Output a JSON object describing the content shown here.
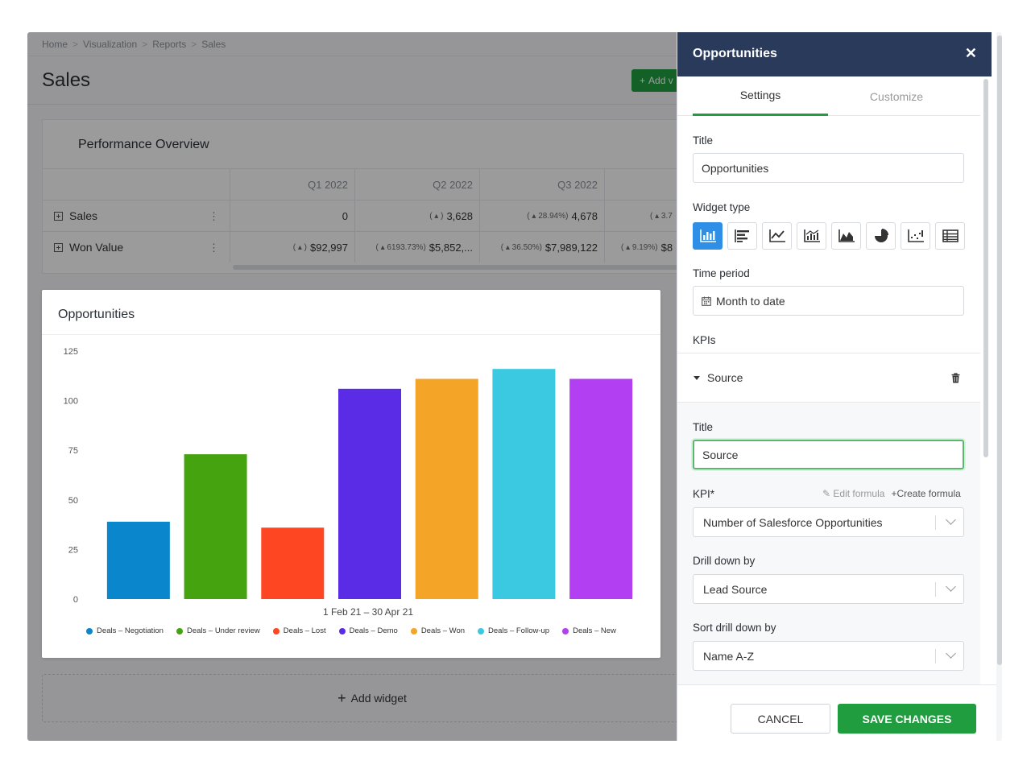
{
  "breadcrumb": [
    "Home",
    "Visualization",
    "Reports",
    "Sales"
  ],
  "page": {
    "title": "Sales",
    "add_button": "Add v"
  },
  "performance": {
    "title": "Performance Overview",
    "columns": [
      "Q1 2022",
      "Q2 2022",
      "Q3 2022"
    ],
    "rows": [
      {
        "label": "Sales",
        "values": [
          {
            "change": "",
            "value": "0"
          },
          {
            "change": "( ▴ )",
            "value": "3,628"
          },
          {
            "change": "( ▴ 28.94%)",
            "value": "4,678"
          },
          {
            "change": "( ▴ 3.7",
            "value": ""
          }
        ]
      },
      {
        "label": "Won Value",
        "values": [
          {
            "change": "( ▴ )",
            "value": "$92,997"
          },
          {
            "change": "( ▴ 6193.73%)",
            "value": "$5,852,..."
          },
          {
            "change": "( ▴ 36.50%)",
            "value": "$7,989,122"
          },
          {
            "change": "( ▴ 9.19%)",
            "value": "$8"
          }
        ]
      }
    ]
  },
  "widget": {
    "title": "Opportunities"
  },
  "chart_data": {
    "type": "bar",
    "title": "Opportunities",
    "xlabel": "1 Feb 21 – 30 Apr 21",
    "ylabel": "",
    "ylim": [
      0,
      125
    ],
    "yticks": [
      0,
      25,
      50,
      75,
      100,
      125
    ],
    "categories": [
      "Deals – Negotiation",
      "Deals – Under review",
      "Deals – Lost",
      "Deals – Demo",
      "Deals – Won",
      "Deals – Follow-up",
      "Deals – New"
    ],
    "values": [
      39,
      73,
      36,
      106,
      111,
      116,
      111
    ],
    "colors": [
      "#0a86cc",
      "#44a30f",
      "#ff4622",
      "#5a2ce6",
      "#f4a426",
      "#3bc9e2",
      "#b23ff2"
    ],
    "legend": "bottom",
    "grid": false
  },
  "add_widget": "Add widget",
  "panel": {
    "title": "Opportunities",
    "tabs": [
      "Settings",
      "Customize"
    ],
    "title_label": "Title",
    "title_value": "Opportunities",
    "widget_type_label": "Widget type",
    "widget_types": [
      "bar-chart-icon",
      "horizontal-bar-icon",
      "line-chart-icon",
      "combo-chart-icon",
      "area-chart-icon",
      "pie-chart-icon",
      "scatter-chart-icon",
      "table-icon"
    ],
    "time_period_label": "Time period",
    "time_period_value": "Month to date",
    "kpis_label": "KPIs",
    "kpi_name": "Source",
    "kpi_title_label": "Title",
    "kpi_title_value": "Source",
    "kpi_label": "KPI*",
    "edit_formula": "Edit formula",
    "create_formula": "Create formula",
    "kpi_value": "Number of Salesforce Opportunities",
    "drill_label": "Drill down by",
    "drill_value": "Lead Source",
    "sort_label": "Sort drill down by",
    "sort_value": "Name A-Z",
    "cancel": "CANCEL",
    "save": "SAVE CHANGES"
  }
}
